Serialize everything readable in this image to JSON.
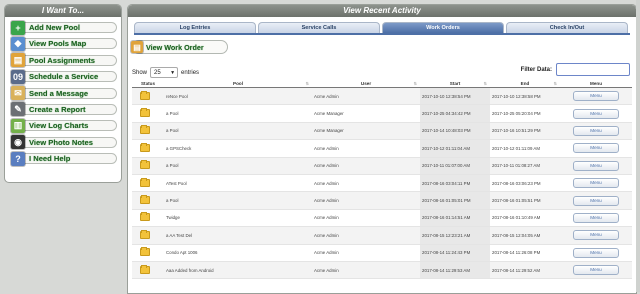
{
  "left_panel": {
    "title": "I Want To...",
    "items": [
      {
        "label": "Add New Pool",
        "icon": "add-pool-icon",
        "color": "#3aa54a",
        "glyph": "+"
      },
      {
        "label": "View Pools Map",
        "icon": "map-icon",
        "color": "#5b8fd0",
        "glyph": "◆"
      },
      {
        "label": "Pool Assignments",
        "icon": "assignments-icon",
        "color": "#e0a33a",
        "glyph": "▤"
      },
      {
        "label": "Schedule a Service",
        "icon": "calendar-icon",
        "color": "#5a6b8a",
        "glyph": "09"
      },
      {
        "label": "Send a Message",
        "icon": "envelope-icon",
        "color": "#d9b15a",
        "glyph": "✉"
      },
      {
        "label": "Create a Report",
        "icon": "report-icon",
        "color": "#6c6f74",
        "glyph": "✎"
      },
      {
        "label": "View Log Charts",
        "icon": "chart-icon",
        "color": "#74b04a",
        "glyph": "▥"
      },
      {
        "label": "View Photo Notes",
        "icon": "camera-icon",
        "color": "#333333",
        "glyph": "◉"
      },
      {
        "label": "I Need Help",
        "icon": "help-icon",
        "color": "#5a7ec0",
        "glyph": "?"
      }
    ]
  },
  "right_panel": {
    "title": "View Recent Activity",
    "tabs": [
      "Log Entries",
      "Service Calls",
      "Work Orders",
      "Check In/Out"
    ],
    "active_tab": 2,
    "view_button": {
      "label": "View Work Order",
      "icon": "work-order-icon"
    },
    "show": {
      "prefix": "Show",
      "value": "25",
      "suffix": "entries"
    },
    "filter_label": "Filter Data:",
    "filter_placeholder": "",
    "columns": [
      "Status",
      "Pool",
      "User",
      "Start",
      "End",
      "Menu"
    ],
    "rows": [
      {
        "pool": "reNce Pool",
        "user": "Acme Admin",
        "start": "2017-10-10 12:38:54 PM",
        "end": "2017-10-10 12:38:58 PM",
        "menu": "Menu"
      },
      {
        "pool": "a Pool",
        "user": "Acme Manager",
        "start": "2017-10-25 04:34:42 PM",
        "end": "2017-10-25 05:20:04 PM",
        "menu": "Menu"
      },
      {
        "pool": "a Pool",
        "user": "Acme Manager",
        "start": "2017-10-14 10:48:03 PM",
        "end": "2017-10-16 10:51:29 PM",
        "menu": "Menu"
      },
      {
        "pool": "a GPSCheck",
        "user": "Acme Admin",
        "start": "2017-10-12 01:11:04 AM",
        "end": "2017-10-12 01:11:09 AM",
        "menu": "Menu"
      },
      {
        "pool": "a Pool",
        "user": "Acme Admin",
        "start": "2017-10-11 01:07:00 AM",
        "end": "2017-10-11 01:08:27 AM",
        "menu": "Menu"
      },
      {
        "pool": "ATest Pool",
        "user": "Acme Admin",
        "start": "2017-08-16 03:04:11 PM",
        "end": "2017-08-16 03:06:23 PM",
        "menu": "Menu"
      },
      {
        "pool": "a Pool",
        "user": "Acme Admin",
        "start": "2017-08-16 01:05:01 PM",
        "end": "2017-08-16 01:05:51 PM",
        "menu": "Menu"
      },
      {
        "pool": "Twidge",
        "user": "Acme Admin",
        "start": "2017-08-16 01:14:51 AM",
        "end": "2017-08-16 01:10:49 AM",
        "menu": "Menu"
      },
      {
        "pool": "a AA Test Del",
        "user": "Acme Admin",
        "start": "2017-08-15 12:23:21 AM",
        "end": "2017-08-15 12:04:05 AM",
        "menu": "Menu"
      },
      {
        "pool": "Condo Apt 1006",
        "user": "Acme Admin",
        "start": "2017-08-14 11:24:43 PM",
        "end": "2017-08-14 11:26:08 PM",
        "menu": "Menu"
      },
      {
        "pool": "Aaa Added from Android",
        "user": "Acme Admin",
        "start": "2017-08-14 11:29:53 AM",
        "end": "2017-08-14 11:29:52 AM",
        "menu": "Menu"
      }
    ]
  }
}
